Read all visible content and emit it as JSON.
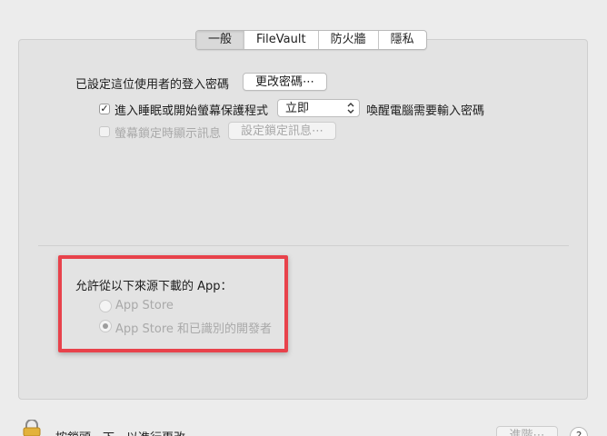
{
  "tabs": [
    {
      "label": "一般",
      "active": true
    },
    {
      "label": "FileVault",
      "active": false
    },
    {
      "label": "防火牆",
      "active": false
    },
    {
      "label": "隱私",
      "active": false
    }
  ],
  "general": {
    "password_label": "已設定這位使用者的登入密碼",
    "change_password_button": "更改密碼⋯",
    "require_password": {
      "checked": true,
      "label_before": "進入睡眠或開始螢幕保護程式",
      "delay_value": "立即",
      "label_after": "喚醒電腦需要輸入密碼"
    },
    "lock_message": {
      "checked": false,
      "enabled": false,
      "label": "螢幕鎖定時顯示訊息",
      "set_button": "設定鎖定訊息⋯"
    }
  },
  "allow_apps": {
    "heading": "允許從以下來源下載的 App：",
    "options": [
      {
        "label": "App Store",
        "selected": false
      },
      {
        "label": "App Store 和已識別的開發者",
        "selected": true
      }
    ]
  },
  "footer": {
    "lock_text": "按鎖頭一下，以進行更改。",
    "advanced_button": "進階⋯",
    "help_label": "?"
  },
  "colors": {
    "highlight_border": "#e8424b",
    "pane_background": "#e3e3e3"
  }
}
